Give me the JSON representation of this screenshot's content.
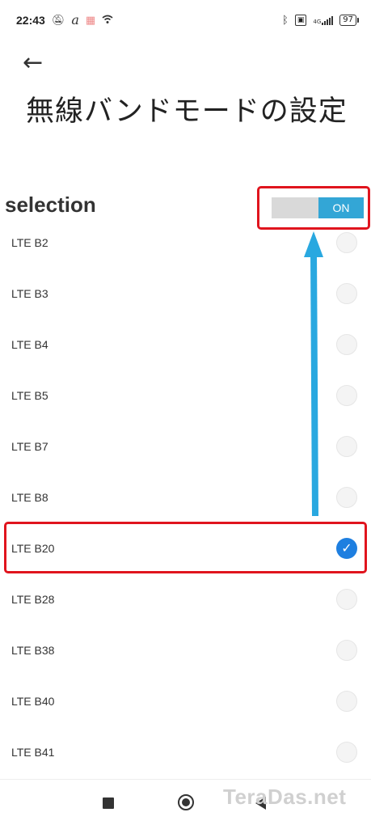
{
  "status_bar": {
    "time": "22:43",
    "left_icons": [
      "mute-bell-icon",
      "a-notification-icon",
      "sim-notification-icon",
      "wifi-icon"
    ],
    "right_icons": [
      "bluetooth-icon",
      "volte-icon",
      "4g-signal-icon"
    ],
    "network_label": "4G",
    "battery_percent": "97"
  },
  "header": {
    "back_icon": "←",
    "title": "無線バンドモードの設定"
  },
  "section": {
    "title": "selection",
    "toggle_label": "ON",
    "toggle_state": "on"
  },
  "bands": [
    {
      "label": "LTE B2",
      "checked": false
    },
    {
      "label": "LTE B3",
      "checked": false
    },
    {
      "label": "LTE B4",
      "checked": false
    },
    {
      "label": "LTE B5",
      "checked": false
    },
    {
      "label": "LTE B7",
      "checked": false
    },
    {
      "label": "LTE B8",
      "checked": false
    },
    {
      "label": "LTE B20",
      "checked": true
    },
    {
      "label": "LTE B28",
      "checked": false
    },
    {
      "label": "LTE B38",
      "checked": false
    },
    {
      "label": "LTE B40",
      "checked": false
    },
    {
      "label": "LTE B41",
      "checked": false
    }
  ],
  "check_glyph": "✓",
  "watermark": "TeraDas.net",
  "colors": {
    "toggle_on": "#33a6d6",
    "radio_checked": "#1e7fe0",
    "highlight": "#e0141e",
    "arrow": "#29a8e0"
  }
}
